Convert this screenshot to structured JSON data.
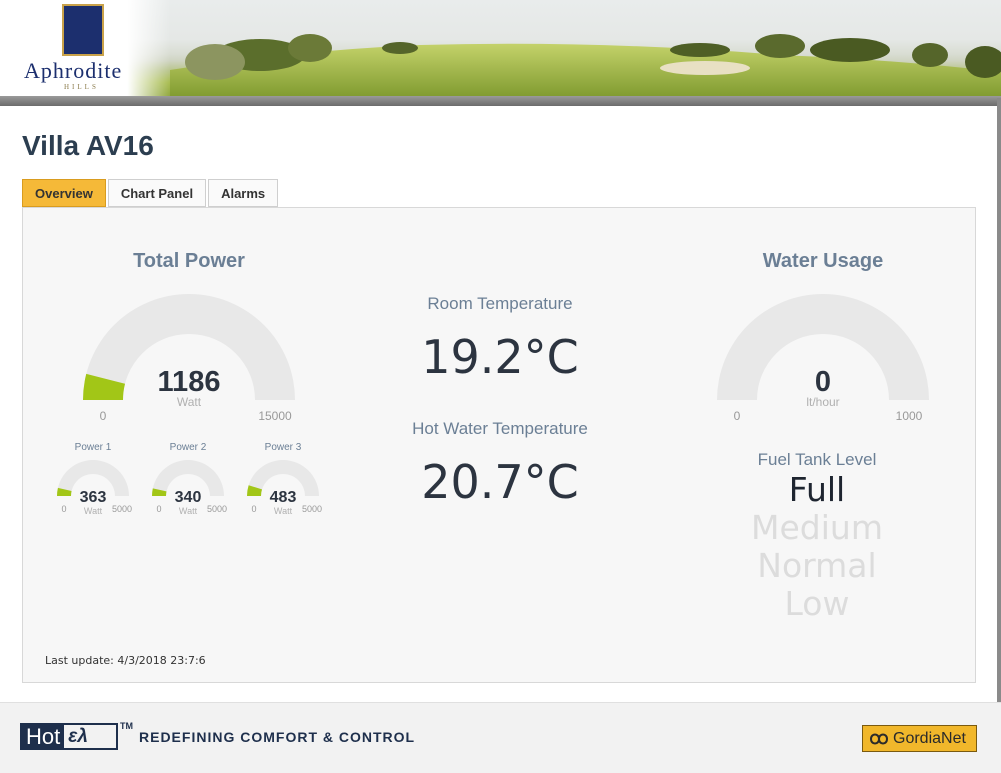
{
  "header": {
    "brand_name": "Aphrodite",
    "brand_sub": "HILLS"
  },
  "page": {
    "title": "Villa AV16"
  },
  "tabs": [
    {
      "label": "Overview",
      "active": true
    },
    {
      "label": "Chart Panel",
      "active": false
    },
    {
      "label": "Alarms",
      "active": false
    }
  ],
  "total_power": {
    "title": "Total Power",
    "value": "1186",
    "unit": "Watt",
    "min": "0",
    "max": "15000",
    "fill_fraction": 0.0791
  },
  "sub_power": [
    {
      "label": "Power 1",
      "value": "363",
      "unit": "Watt",
      "min": "0",
      "max": "5000",
      "fill_fraction": 0.0726
    },
    {
      "label": "Power 2",
      "value": "340",
      "unit": "Watt",
      "min": "0",
      "max": "5000",
      "fill_fraction": 0.068
    },
    {
      "label": "Power 3",
      "value": "483",
      "unit": "Watt",
      "min": "0",
      "max": "5000",
      "fill_fraction": 0.0966
    }
  ],
  "room_temperature": {
    "label": "Room Temperature",
    "value": "19.2°C"
  },
  "hot_water_temperature": {
    "label": "Hot Water Temperature",
    "value": "20.7°C"
  },
  "water_usage": {
    "title": "Water Usage",
    "value": "0",
    "unit": "lt/hour",
    "min": "0",
    "max": "1000",
    "fill_fraction": 0
  },
  "fuel_tank": {
    "title": "Fuel Tank Level",
    "levels": [
      "Full",
      "Medium",
      "Normal",
      "Low"
    ],
    "current": "Full"
  },
  "status": {
    "last_update": "Last update: 4/3/2018 23:7:6"
  },
  "footer": {
    "hotel_hot": "Hot",
    "hotel_el": "ελ",
    "trademark": "TM",
    "tagline": "REDEFINING COMFORT & CONTROL",
    "partner": "GordiaNet"
  },
  "colors": {
    "gauge_fill": "#a2c617",
    "gauge_track": "#e8e8e8",
    "active_tab": "#f5b938"
  }
}
